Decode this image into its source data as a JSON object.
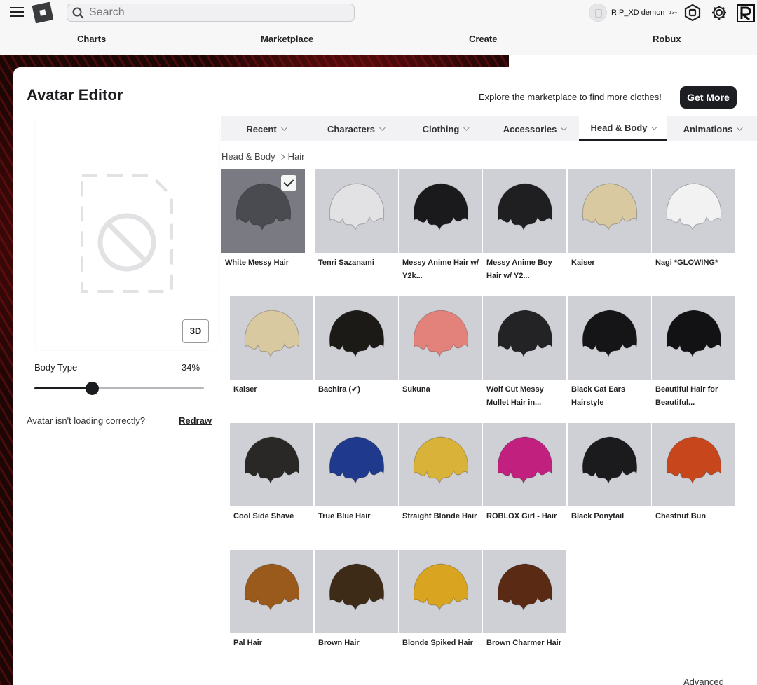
{
  "topbar": {
    "search_placeholder": "Search",
    "username": "RIP_XD demon",
    "age_badge": "13+",
    "nav": [
      "Charts",
      "Marketplace",
      "Create",
      "Robux"
    ]
  },
  "editor": {
    "title": "Avatar Editor",
    "explore_text": "Explore the marketplace to find more clothes!",
    "get_more_label": "Get More",
    "view_3d_label": "3D",
    "body_type_label": "Body Type",
    "body_type_value": "34%",
    "body_type_fraction": 0.34,
    "loading_question": "Avatar isn't loading correctly?",
    "redraw_label": "Redraw",
    "advanced_label": "Advanced"
  },
  "tabs": [
    {
      "label": "Recent",
      "active": false
    },
    {
      "label": "Characters",
      "active": false
    },
    {
      "label": "Clothing",
      "active": false
    },
    {
      "label": "Accessories",
      "active": false
    },
    {
      "label": "Head & Body",
      "active": true
    },
    {
      "label": "Animations",
      "active": false
    }
  ],
  "breadcrumb": {
    "parent": "Head & Body",
    "current": "Hair"
  },
  "items": [
    {
      "name": "White Messy Hair",
      "color": "#4a4b50",
      "selected": true,
      "icon": "hair-icon"
    },
    {
      "name": "Tenri Sazanami",
      "color": "#e2e2e4",
      "selected": false,
      "icon": "hair-icon"
    },
    {
      "name": "Messy Anime Hair w/ Y2k...",
      "color": "#1a1a1c",
      "selected": false,
      "icon": "hair-icon"
    },
    {
      "name": "Messy Anime Boy Hair w/ Y2...",
      "color": "#1f1f21",
      "selected": false,
      "icon": "hair-icon"
    },
    {
      "name": "Kaiser",
      "color": "#d8c9a0",
      "selected": false,
      "icon": "hair-icon"
    },
    {
      "name": "Nagi *GLOWING*",
      "color": "#f2f2f2",
      "selected": false,
      "icon": "hair-icon"
    },
    {
      "name": "Kaiser",
      "color": "#d8c9a0",
      "selected": false,
      "icon": "hair-icon"
    },
    {
      "name": "Bachira (✔)",
      "color": "#1c1a16",
      "selected": false,
      "icon": "hair-icon"
    },
    {
      "name": "Sukuna",
      "color": "#e3827a",
      "selected": false,
      "icon": "hair-icon"
    },
    {
      "name": "Wolf Cut Messy Mullet Hair in...",
      "color": "#232325",
      "selected": false,
      "icon": "hair-icon"
    },
    {
      "name": "Black Cat Ears Hairstyle",
      "color": "#151517",
      "selected": false,
      "icon": "hair-icon"
    },
    {
      "name": "Beautiful Hair for Beautiful...",
      "color": "#121214",
      "selected": false,
      "icon": "hair-icon"
    },
    {
      "name": "Cool Side Shave",
      "color": "#2a2826",
      "selected": false,
      "icon": "hair-icon"
    },
    {
      "name": "True Blue Hair",
      "color": "#1f3a8c",
      "selected": false,
      "icon": "hair-icon"
    },
    {
      "name": "Straight Blonde Hair",
      "color": "#d9b23a",
      "selected": false,
      "icon": "hair-icon"
    },
    {
      "name": "ROBLOX Girl - Hair",
      "color": "#c2207e",
      "selected": false,
      "icon": "hair-icon"
    },
    {
      "name": "Black Ponytail",
      "color": "#1b1b1d",
      "selected": false,
      "icon": "hair-icon"
    },
    {
      "name": "Chestnut Bun",
      "color": "#c8461c",
      "selected": false,
      "icon": "hair-icon"
    },
    {
      "name": "Pal Hair",
      "color": "#9a5a1c",
      "selected": false,
      "icon": "hair-icon"
    },
    {
      "name": "Brown Hair",
      "color": "#3d2b18",
      "selected": false,
      "icon": "hair-icon"
    },
    {
      "name": "Blonde Spiked Hair",
      "color": "#d9a520",
      "selected": false,
      "icon": "hair-icon"
    },
    {
      "name": "Brown Charmer Hair",
      "color": "#5a2a14",
      "selected": false,
      "icon": "hair-icon"
    }
  ]
}
